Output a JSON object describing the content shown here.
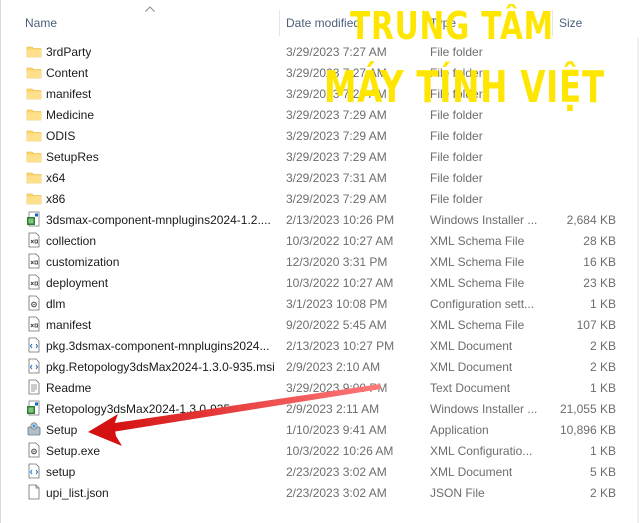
{
  "columns": {
    "name": "Name",
    "date": "Date modified",
    "type": "Type",
    "size": "Size"
  },
  "files": [
    {
      "name": "3rdParty",
      "date": "3/29/2023 7:27 AM",
      "type": "File folder",
      "size": "",
      "icon": "folder-icon"
    },
    {
      "name": "Content",
      "date": "3/29/2023 7:27 AM",
      "type": "File folder",
      "size": "",
      "icon": "folder-icon"
    },
    {
      "name": "manifest",
      "date": "3/29/2023 7:29 AM",
      "type": "File folder",
      "size": "",
      "icon": "folder-icon"
    },
    {
      "name": "Medicine",
      "date": "3/29/2023 7:29 AM",
      "type": "File folder",
      "size": "",
      "icon": "folder-icon"
    },
    {
      "name": "ODIS",
      "date": "3/29/2023 7:29 AM",
      "type": "File folder",
      "size": "",
      "icon": "folder-icon"
    },
    {
      "name": "SetupRes",
      "date": "3/29/2023 7:29 AM",
      "type": "File folder",
      "size": "",
      "icon": "folder-icon"
    },
    {
      "name": "x64",
      "date": "3/29/2023 7:31 AM",
      "type": "File folder",
      "size": "",
      "icon": "folder-icon"
    },
    {
      "name": "x86",
      "date": "3/29/2023 7:29 AM",
      "type": "File folder",
      "size": "",
      "icon": "folder-icon"
    },
    {
      "name": "3dsmax-component-mnplugins2024-1.2....",
      "date": "2/13/2023 10:26 PM",
      "type": "Windows Installer ...",
      "size": "2,684 KB",
      "icon": "installer-icon"
    },
    {
      "name": "collection",
      "date": "10/3/2022 10:27 AM",
      "type": "XML Schema File",
      "size": "28 KB",
      "icon": "xml-file-icon"
    },
    {
      "name": "customization",
      "date": "12/3/2020 3:31 PM",
      "type": "XML Schema File",
      "size": "16 KB",
      "icon": "xml-file-icon"
    },
    {
      "name": "deployment",
      "date": "10/3/2022 10:27 AM",
      "type": "XML Schema File",
      "size": "23 KB",
      "icon": "xml-file-icon"
    },
    {
      "name": "dlm",
      "date": "3/1/2023 10:08 PM",
      "type": "Configuration sett...",
      "size": "1 KB",
      "icon": "config-file-icon"
    },
    {
      "name": "manifest",
      "date": "9/20/2022 5:45 AM",
      "type": "XML Schema File",
      "size": "107 KB",
      "icon": "xml-file-icon"
    },
    {
      "name": "pkg.3dsmax-component-mnplugins2024...",
      "date": "2/13/2023 10:27 PM",
      "type": "XML Document",
      "size": "2 KB",
      "icon": "xml-doc-icon"
    },
    {
      "name": "pkg.Retopology3dsMax2024-1.3.0-935.msi",
      "date": "2/9/2023 2:10 AM",
      "type": "XML Document",
      "size": "2 KB",
      "icon": "xml-doc-icon"
    },
    {
      "name": "Readme",
      "date": "3/29/2023 9:00 PM",
      "type": "Text Document",
      "size": "1 KB",
      "icon": "text-doc-icon"
    },
    {
      "name": "Retopology3dsMax2024-1.3.0-935",
      "date": "2/9/2023 2:11 AM",
      "type": "Windows Installer ...",
      "size": "21,055 KB",
      "icon": "installer-icon"
    },
    {
      "name": "Setup",
      "date": "1/10/2023 9:41 AM",
      "type": "Application",
      "size": "10,896 KB",
      "icon": "setup-app-icon"
    },
    {
      "name": "Setup.exe",
      "date": "10/3/2022 10:26 AM",
      "type": "XML Configuratio...",
      "size": "1 KB",
      "icon": "config-file-icon"
    },
    {
      "name": "setup",
      "date": "2/23/2023 3:02 AM",
      "type": "XML Document",
      "size": "5 KB",
      "icon": "xml-doc-icon"
    },
    {
      "name": "upi_list.json",
      "date": "2/23/2023 3:02 AM",
      "type": "JSON File",
      "size": "2 KB",
      "icon": "blank-file-icon"
    }
  ],
  "watermark": {
    "line1": "TRUNG TÂM",
    "line2": "MÁY TÍNH VIỆT",
    "color": "#ffe600"
  },
  "colors": {
    "folder": "#ffd666",
    "arrow": "#e11919",
    "header_text": "#4c607a"
  }
}
